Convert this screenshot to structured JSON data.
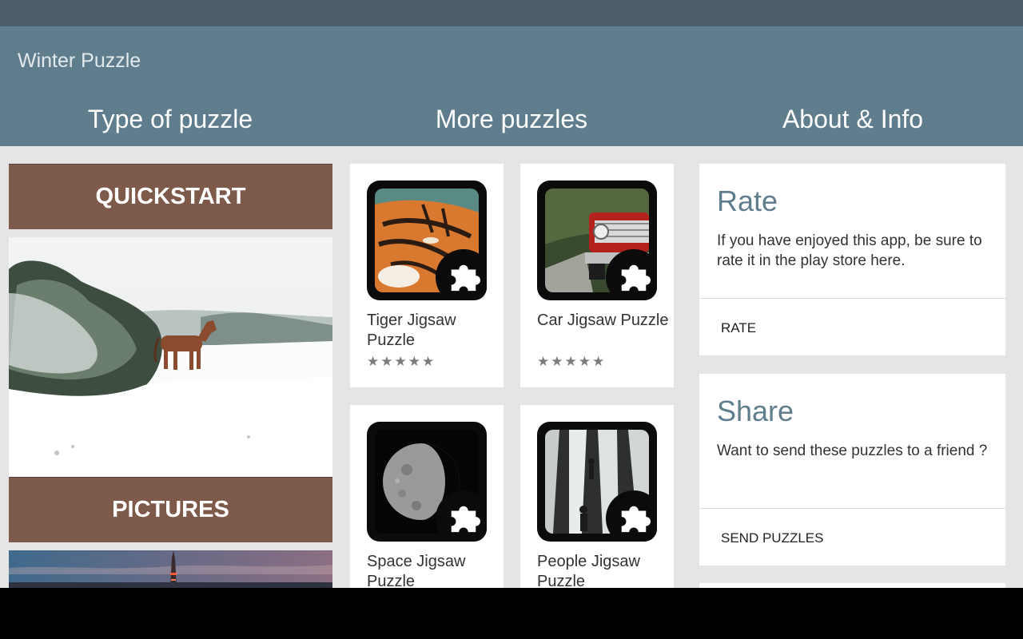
{
  "app": {
    "title": "Winter Puzzle"
  },
  "tabs": [
    {
      "label": "Type of puzzle"
    },
    {
      "label": "More puzzles"
    },
    {
      "label": "About & Info"
    }
  ],
  "puzzle_types": [
    {
      "label": "QUICKSTART"
    },
    {
      "label": "PICTURES"
    }
  ],
  "more_puzzles": [
    {
      "name": "Tiger Jigsaw Puzzle",
      "rating_stars": "★★★★★"
    },
    {
      "name": "Car Jigsaw Puzzle",
      "rating_stars": "★★★★★"
    },
    {
      "name": "Space Jigsaw Puzzle"
    },
    {
      "name": "People Jigsaw Puzzle"
    }
  ],
  "about": {
    "rate": {
      "title": "Rate",
      "description": "If you have enjoyed this app, be sure to rate it in the play store here.",
      "action": "RATE"
    },
    "share": {
      "title": "Share",
      "description": "Want to send these puzzles to a friend ?",
      "action": "SEND PUZZLES"
    }
  },
  "colors": {
    "status_bar": "#4a5d69",
    "app_bar": "#5f7d8c",
    "banner": "#7e5a4a",
    "background": "#e5e5e5"
  }
}
